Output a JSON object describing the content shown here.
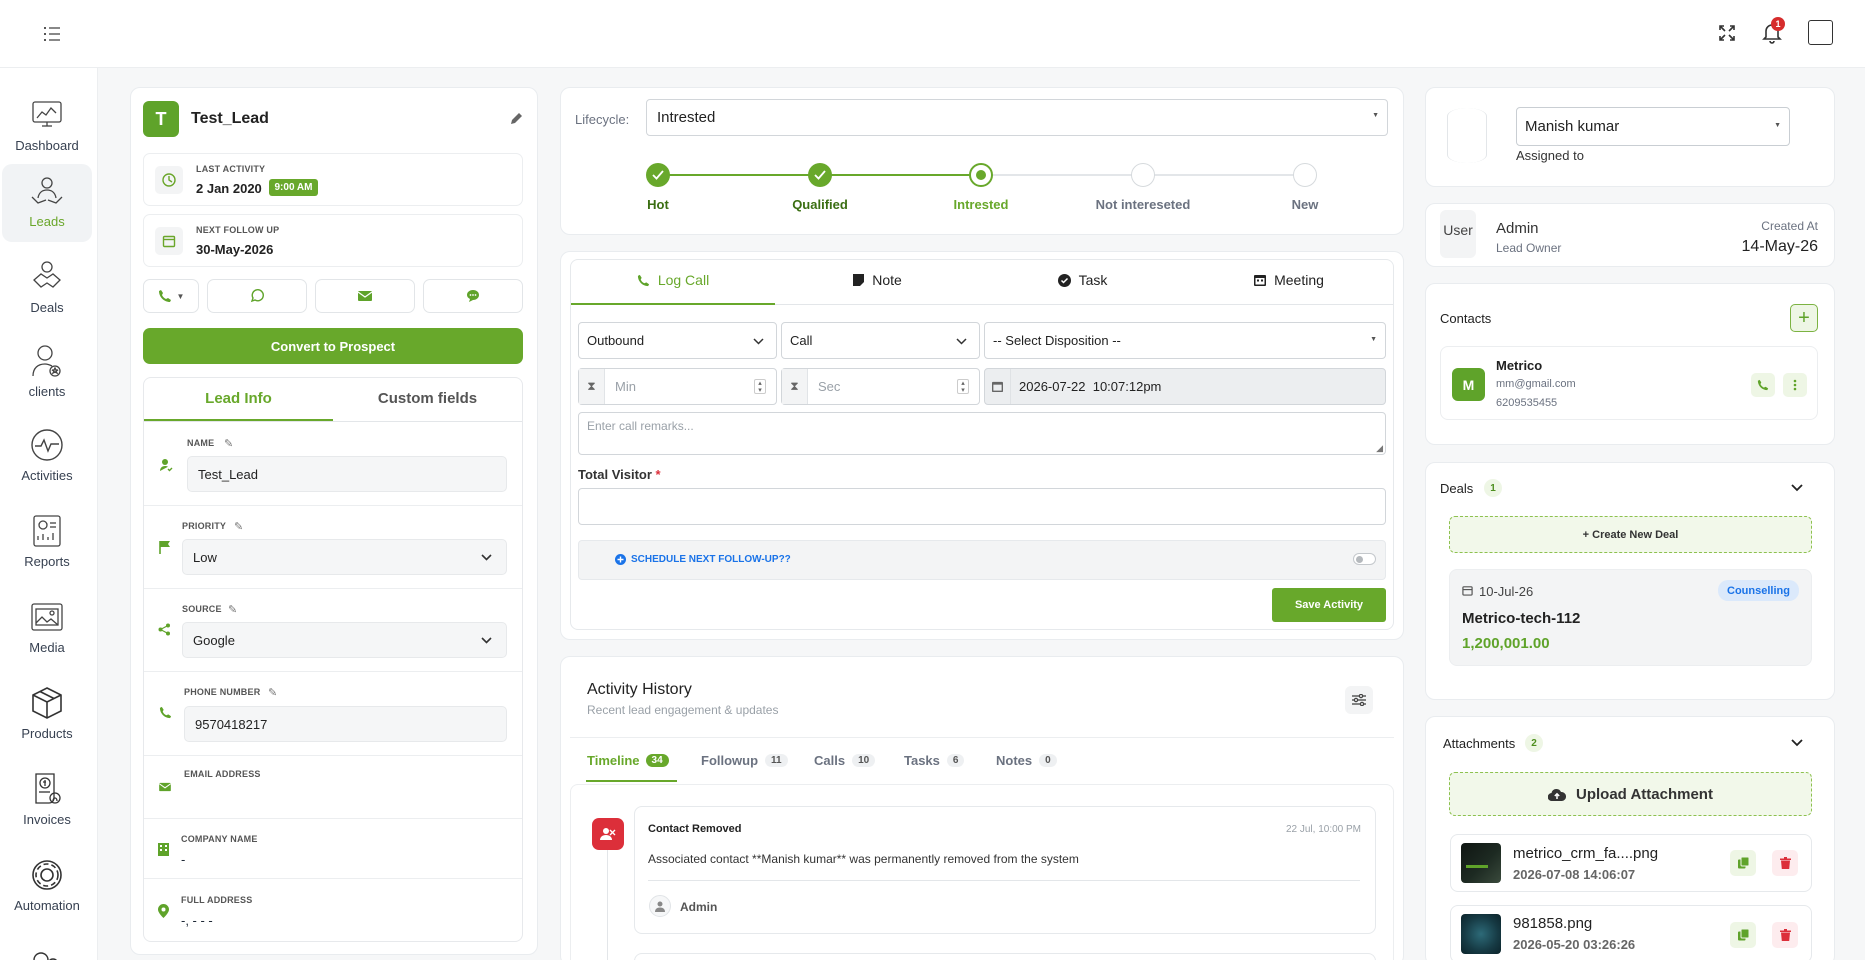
{
  "topbar": {
    "notifications_count": "1"
  },
  "sidebar": {
    "items": [
      {
        "label": "Dashboard"
      },
      {
        "label": "Leads"
      },
      {
        "label": "Deals"
      },
      {
        "label": "clients"
      },
      {
        "label": "Activities"
      },
      {
        "label": "Reports"
      },
      {
        "label": "Media"
      },
      {
        "label": "Products"
      },
      {
        "label": "Invoices"
      },
      {
        "label": "Automation"
      }
    ]
  },
  "lead": {
    "avatar_letter": "T",
    "name": "Test_Lead",
    "last_activity_label": "LAST ACTIVITY",
    "last_activity_date": "2 Jan 2020",
    "last_activity_time": "9:00 AM",
    "next_follow_up_label": "NEXT FOLLOW UP",
    "next_follow_up_date": "30-May-2026",
    "convert_label": "Convert to Prospect",
    "tabs": [
      "Lead Info",
      "Custom fields"
    ],
    "fields": {
      "name_label": "NAME",
      "name_value": "Test_Lead",
      "priority_label": "PRIORITY",
      "priority_value": "Low",
      "source_label": "SOURCE",
      "source_value": "Google",
      "phone_label": "PHONE NUMBER",
      "phone_value": "9570418217",
      "email_label": "EMAIL ADDRESS",
      "email_value": "",
      "company_label": "COMPANY NAME",
      "company_value": "-",
      "address_label": "FULL ADDRESS",
      "address_value": "-, - - -"
    }
  },
  "lifecycle": {
    "label": "Lifecycle:",
    "selected": "Intrested",
    "stages": [
      {
        "name": "Hot",
        "state": "done"
      },
      {
        "name": "Qualified",
        "state": "done"
      },
      {
        "name": "Intrested",
        "state": "current"
      },
      {
        "name": "Not intereseted",
        "state": "todo"
      },
      {
        "name": "New",
        "state": "todo"
      }
    ]
  },
  "activity_form": {
    "tabs": [
      "Log Call",
      "Note",
      "Task",
      "Meeting"
    ],
    "direction": "Outbound",
    "type": "Call",
    "disposition_placeholder": "-- Select Disposition --",
    "min_placeholder": "Min",
    "sec_placeholder": "Sec",
    "datetime": "2026-07-22  10:07:12pm",
    "remarks_placeholder": "Enter call remarks...",
    "total_visitor_label": "Total Visitor",
    "required_mark": "*",
    "schedule_label": "SCHEDULE NEXT FOLLOW-UP??",
    "save_label": "Save Activity"
  },
  "history": {
    "title": "Activity History",
    "subtitle": "Recent lead engagement & updates",
    "tabs": [
      {
        "label": "Timeline",
        "count": "34"
      },
      {
        "label": "Followup",
        "count": "11"
      },
      {
        "label": "Calls",
        "count": "10"
      },
      {
        "label": "Tasks",
        "count": "6"
      },
      {
        "label": "Notes",
        "count": "0"
      }
    ],
    "entry": {
      "title": "Contact Removed",
      "time": "22 Jul, 10:00 PM",
      "body": "Associated contact **Manish kumar** was permanently removed from the system",
      "author": "Admin"
    }
  },
  "assignee": {
    "name": "Manish kumar",
    "label": "Assigned to"
  },
  "owner": {
    "user_label": "User",
    "name": "Admin",
    "role": "Lead Owner",
    "created_label": "Created At",
    "created_date": "14-May-26"
  },
  "contacts": {
    "title": "Contacts",
    "item": {
      "avatar": "M",
      "name": "Metrico",
      "email": "mm@gmail.com",
      "phone": "6209535455"
    }
  },
  "deals": {
    "title": "Deals",
    "count": "1",
    "create_label": "+ Create New Deal",
    "item": {
      "date": "10-Jul-26",
      "tag": "Counselling",
      "name": "Metrico-tech-112",
      "amount": "1,200,001.00"
    }
  },
  "attachments": {
    "title": "Attachments",
    "count": "2",
    "upload_label": "Upload Attachment",
    "files": [
      {
        "name": "metrico_crm_fa....png",
        "date": "2026-07-08 14:06:07"
      },
      {
        "name": "981858.png",
        "date": "2026-05-20 03:26:26"
      }
    ]
  },
  "colors": {
    "accent": "#68a82b",
    "danger": "#dc2f3a",
    "link": "#1a73e8"
  }
}
